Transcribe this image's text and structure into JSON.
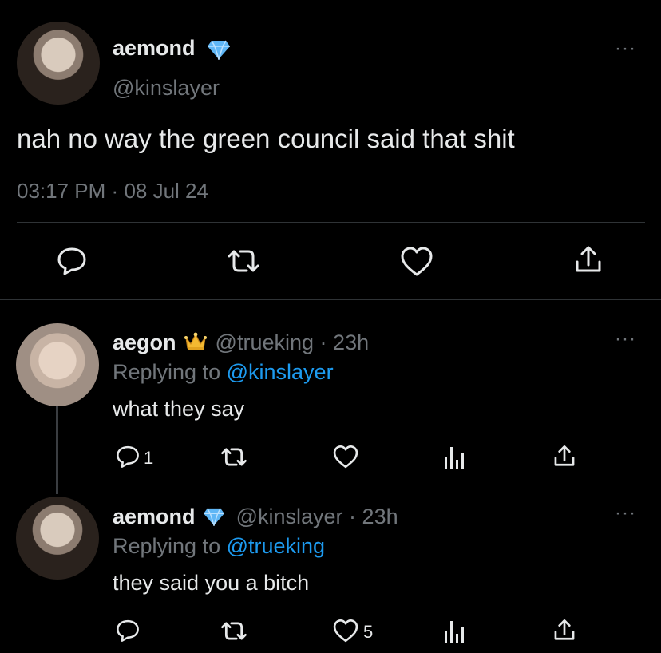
{
  "main_tweet": {
    "name": "aemond",
    "handle": "@kinslayer",
    "text": "nah no way the green council said that shit",
    "time": "03:17 PM",
    "separator": "·",
    "date": "08 Jul 24",
    "more": "···"
  },
  "replies": [
    {
      "name": "aegon",
      "handle": "@trueking",
      "dot": "·",
      "age": "23h",
      "replying_prefix": "Replying to",
      "replying_to": "@kinslayer",
      "text": "what they say",
      "reply_count": "1",
      "like_count": "",
      "more": "···"
    },
    {
      "name": "aemond",
      "handle": "@kinslayer",
      "dot": "·",
      "age": "23h",
      "replying_prefix": "Replying to",
      "replying_to": "@trueking",
      "text": "they said you a bitch",
      "reply_count": "",
      "like_count": "5",
      "more": "···"
    }
  ],
  "colors": {
    "background": "#000000",
    "text": "#e7e9ea",
    "muted": "#71767b",
    "link": "#1d9bf0",
    "verified": "#5fb6f5",
    "crown": "#f3b931"
  },
  "icons": [
    "comment-icon",
    "retweet-icon",
    "like-icon",
    "share-icon",
    "analytics-icon",
    "verified-diamond-icon",
    "crown-icon",
    "more-icon"
  ]
}
